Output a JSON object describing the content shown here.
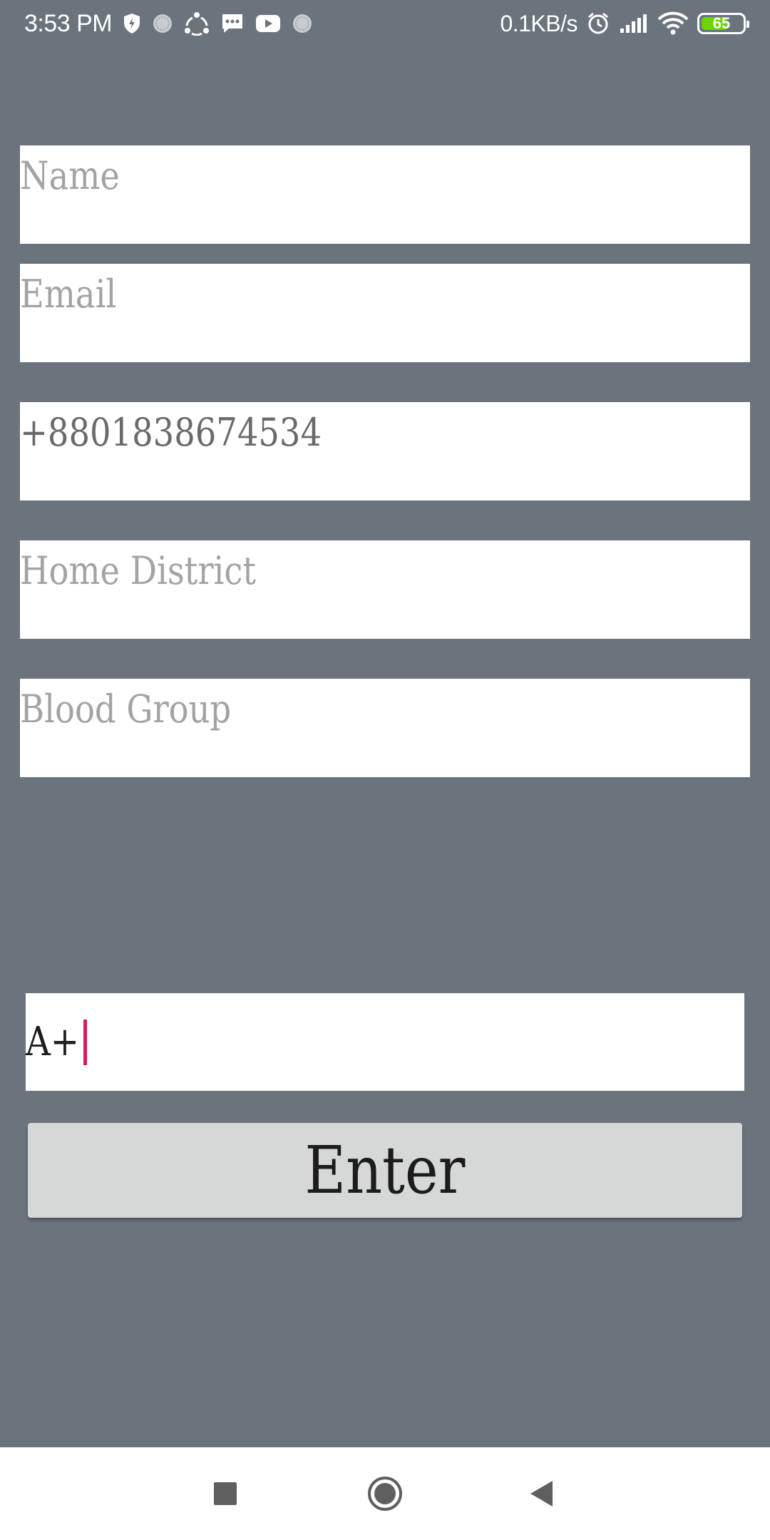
{
  "status_bar": {
    "time": "3:53 PM",
    "network_speed": "0.1KB/s",
    "battery_level": "65",
    "battery_fraction": 0.65,
    "battery_color": "#6dd400",
    "left_icons": [
      "shield-icon",
      "dot-icon",
      "share-icon",
      "message-icon",
      "youtube-icon",
      "dot-icon"
    ],
    "right_icons": [
      "alarm-icon",
      "signal-icon",
      "wifi-icon",
      "battery-icon"
    ]
  },
  "form": {
    "name": {
      "placeholder": "Name",
      "value": ""
    },
    "email": {
      "placeholder": "Email",
      "value": ""
    },
    "phone": {
      "placeholder": "",
      "value": "+8801838674534"
    },
    "home_district": {
      "placeholder": "Home District",
      "value": ""
    },
    "blood_group": {
      "placeholder": "Blood Group",
      "value": ""
    },
    "active_input_value": "A+"
  },
  "enter_button": {
    "label": "Enter"
  },
  "nav_bar": {
    "buttons": [
      "recents-icon",
      "home-icon",
      "back-icon"
    ]
  },
  "colors": {
    "background": "#6b737d",
    "caret": "#d81b60",
    "button": "#d6d7d7"
  }
}
